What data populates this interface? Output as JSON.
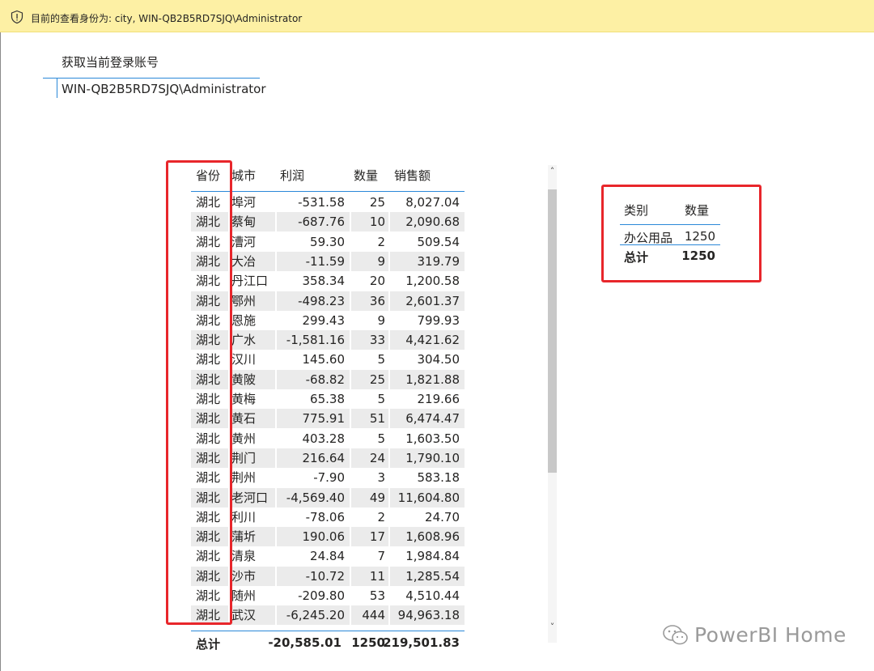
{
  "banner": {
    "text": "目前的查看身份为: city, WIN-QB2B5RD7SJQ\\Administrator",
    "icon": "shield-icon"
  },
  "card": {
    "title": "获取当前登录账号",
    "value": "WIN-QB2B5RD7SJQ\\Administrator"
  },
  "table": {
    "headers": [
      "省份",
      "城市",
      "利润",
      "数量",
      "销售额"
    ],
    "rows": [
      [
        "湖北",
        "埠河",
        "-531.58",
        "25",
        "8,027.04"
      ],
      [
        "湖北",
        "蔡甸",
        "-687.76",
        "10",
        "2,090.68"
      ],
      [
        "湖北",
        "漕河",
        "59.30",
        "2",
        "509.54"
      ],
      [
        "湖北",
        "大冶",
        "-11.59",
        "9",
        "319.79"
      ],
      [
        "湖北",
        "丹江口",
        "358.34",
        "20",
        "1,200.58"
      ],
      [
        "湖北",
        "鄂州",
        "-498.23",
        "36",
        "2,601.37"
      ],
      [
        "湖北",
        "恩施",
        "299.43",
        "9",
        "799.93"
      ],
      [
        "湖北",
        "广水",
        "-1,581.16",
        "33",
        "4,421.62"
      ],
      [
        "湖北",
        "汉川",
        "145.60",
        "5",
        "304.50"
      ],
      [
        "湖北",
        "黄陂",
        "-68.82",
        "25",
        "1,821.88"
      ],
      [
        "湖北",
        "黄梅",
        "65.38",
        "5",
        "219.66"
      ],
      [
        "湖北",
        "黄石",
        "775.91",
        "51",
        "6,474.47"
      ],
      [
        "湖北",
        "黄州",
        "403.28",
        "5",
        "1,603.50"
      ],
      [
        "湖北",
        "荆门",
        "216.64",
        "24",
        "1,790.10"
      ],
      [
        "湖北",
        "荆州",
        "-7.90",
        "3",
        "583.18"
      ],
      [
        "湖北",
        "老河口",
        "-4,569.40",
        "49",
        "11,604.80"
      ],
      [
        "湖北",
        "利川",
        "-78.06",
        "2",
        "24.70"
      ],
      [
        "湖北",
        "蒲圻",
        "190.06",
        "17",
        "1,608.96"
      ],
      [
        "湖北",
        "清泉",
        "24.84",
        "7",
        "1,984.84"
      ],
      [
        "湖北",
        "沙市",
        "-10.72",
        "11",
        "1,285.54"
      ],
      [
        "湖北",
        "随州",
        "-209.80",
        "53",
        "4,510.44"
      ],
      [
        "湖北",
        "武汉",
        "-6,245.20",
        "444",
        "94,963.18"
      ]
    ],
    "total": {
      "label": "总计",
      "profit": "-20,585.01",
      "qty": "1250",
      "sales": "219,501.83"
    }
  },
  "summary": {
    "headers": [
      "类别",
      "数量"
    ],
    "row": [
      "办公用品",
      "1250"
    ],
    "total": [
      "总计",
      "1250"
    ]
  },
  "scrollbar": {
    "up": "˄",
    "down": "˅"
  },
  "watermark": {
    "text": "PowerBI Home",
    "icon": "wechat-icon"
  },
  "colors": {
    "banner_bg": "#fdf0a4",
    "highlight_box": "#e8262b",
    "accent_line": "#2b88d8",
    "alt_row": "#ebebeb"
  }
}
